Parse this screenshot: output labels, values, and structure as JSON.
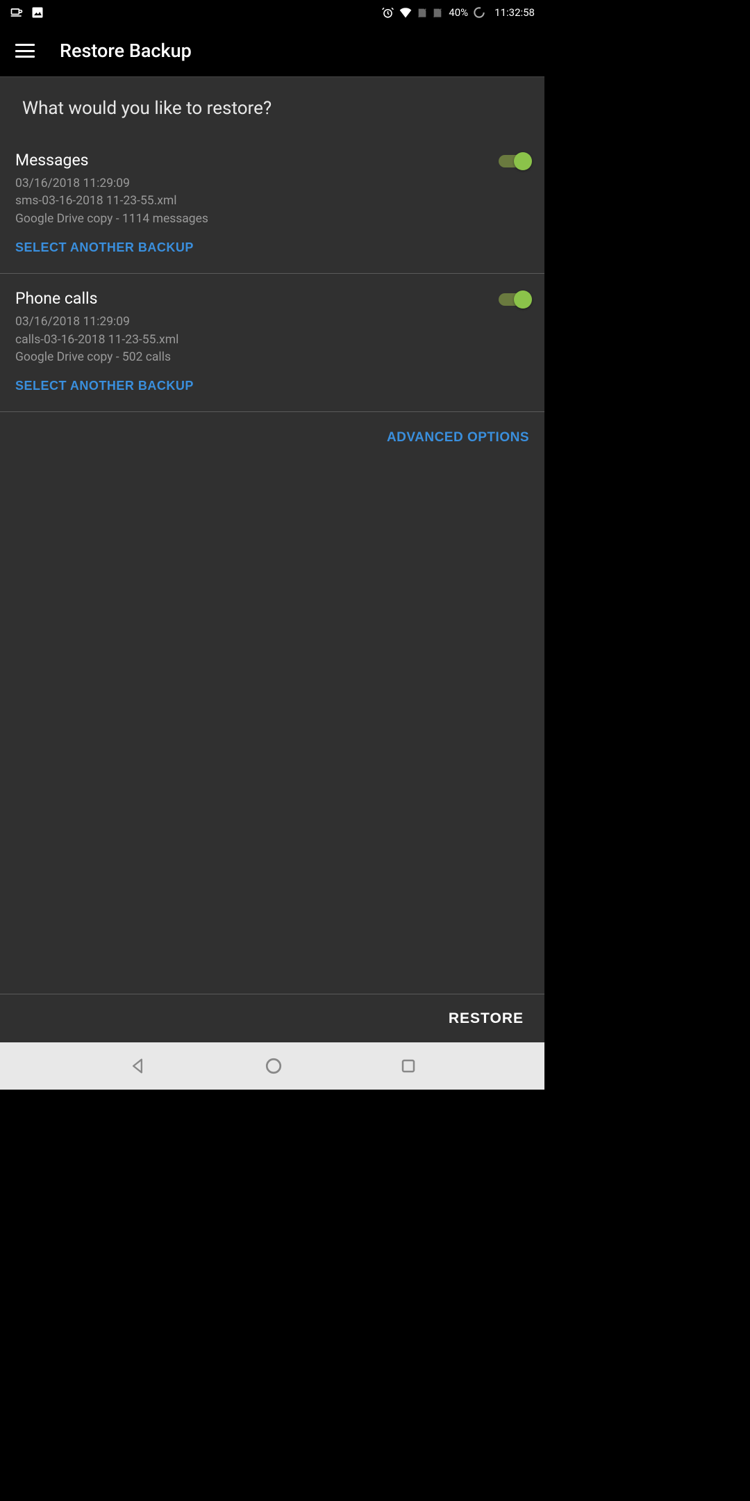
{
  "status_bar": {
    "battery": "40%",
    "time": "11:32:58"
  },
  "app_bar": {
    "title": "Restore Backup"
  },
  "prompt": "What would you like to restore?",
  "sections": [
    {
      "title": "Messages",
      "timestamp": "03/16/2018 11:29:09",
      "filename": "sms-03-16-2018 11-23-55.xml",
      "summary": "Google Drive copy - 1114 messages",
      "action": "SELECT ANOTHER BACKUP",
      "enabled": true
    },
    {
      "title": "Phone calls",
      "timestamp": "03/16/2018 11:29:09",
      "filename": "calls-03-16-2018 11-23-55.xml",
      "summary": "Google Drive copy - 502 calls",
      "action": "SELECT ANOTHER BACKUP",
      "enabled": true
    }
  ],
  "advanced_label": "ADVANCED OPTIONS",
  "restore_label": "RESTORE"
}
